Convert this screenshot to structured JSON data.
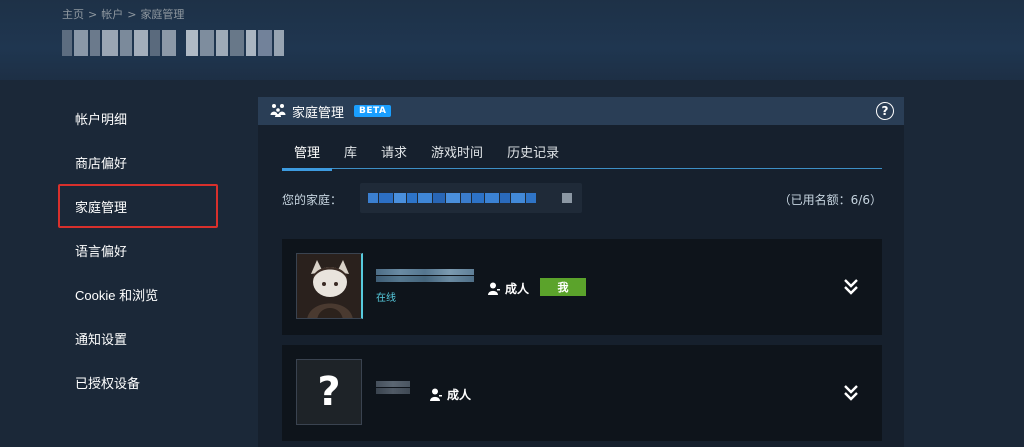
{
  "breadcrumb": [
    "主页",
    "帐户",
    "家庭管理"
  ],
  "breadcrumb_sep": ">",
  "sidebar": {
    "items": [
      {
        "label": "帐户明细"
      },
      {
        "label": "商店偏好"
      },
      {
        "label": "家庭管理",
        "highlighted": true
      },
      {
        "label": "语言偏好"
      },
      {
        "label": "Cookie 和浏览"
      },
      {
        "label": "通知设置"
      },
      {
        "label": "已授权设备"
      }
    ]
  },
  "panel": {
    "title": "家庭管理",
    "badge": "BETA",
    "help_icon": "help-circle-icon",
    "tabs": [
      {
        "label": "管理",
        "active": true
      },
      {
        "label": "库"
      },
      {
        "label": "请求"
      },
      {
        "label": "游戏时间"
      },
      {
        "label": "历史记录"
      }
    ],
    "family_label": "您的家庭：",
    "quota": "（已用名额：6/6）"
  },
  "members": [
    {
      "status": "在线",
      "role": "成人",
      "badge": "我",
      "avatar": "anime-character-avatar",
      "online": true
    },
    {
      "role": "成人",
      "avatar": "question-mark-avatar",
      "online": false
    }
  ],
  "colors": {
    "background": "#1b2838",
    "panel": "#16202d",
    "panel_header": "#2a3e56",
    "accent_blue": "#1a9fff",
    "tab_underline": "#3d9be0",
    "online": "#57cbde",
    "me_badge": "#5ba32b",
    "highlight_box": "#d8302c"
  }
}
